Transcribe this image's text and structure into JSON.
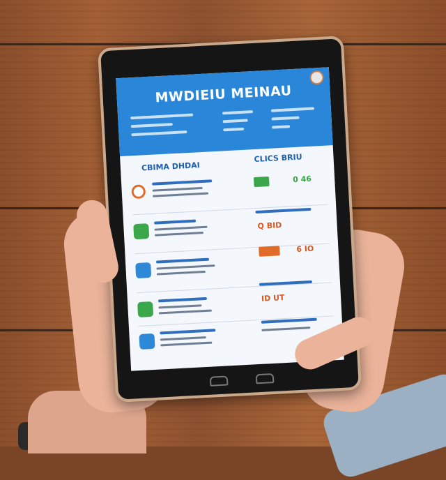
{
  "screen": {
    "title": "MWDIEIU MEINAU",
    "left_section_title": "CBIMA DHDAI",
    "right_section_title": "CLICS BRIU",
    "prices": [
      "0 46",
      "Q BID",
      "6 IO",
      "ID UT"
    ]
  },
  "colors": {
    "header_blue": "#2a86d8",
    "accent_orange": "#e36b2a",
    "accent_green": "#3aa84a",
    "text_blue": "#1e5fab",
    "wood": "#8d5130"
  },
  "icons": [
    "menu-orange-icon",
    "menu-green-icon",
    "menu-blue-icon",
    "menu-green-icon",
    "menu-blue-icon"
  ]
}
